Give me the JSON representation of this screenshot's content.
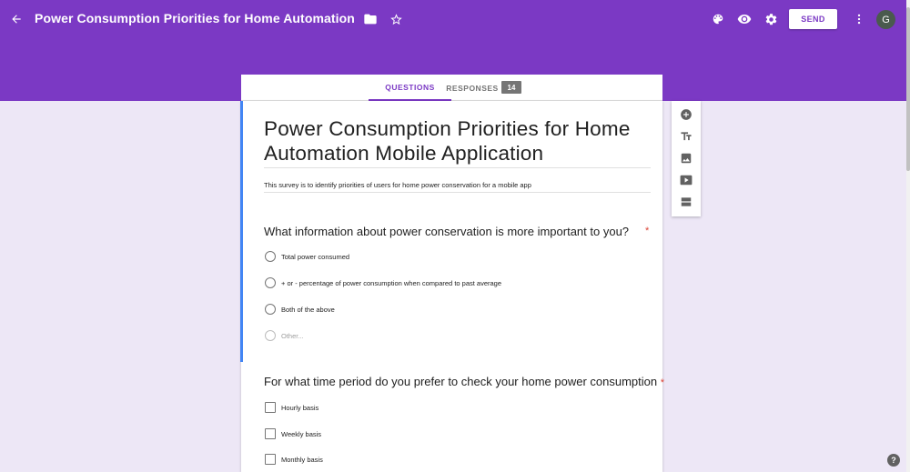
{
  "header": {
    "title": "Power Consumption Priorities for Home Automation Mobile Applic",
    "send_label": "SEND",
    "avatar_letter": "G",
    "icons": [
      "arrow-back-icon",
      "folder-icon",
      "star-icon",
      "palette-icon",
      "eye-icon",
      "gear-icon",
      "more-vert-icon"
    ]
  },
  "tabs": {
    "questions": "QUESTIONS",
    "responses": "RESPONSES",
    "responses_count": "14"
  },
  "form": {
    "title": "Power Consumption Priorities for Home Automation Mobile Application",
    "description": "This survey is to identify priorities of users for home power conservation for a mobile app"
  },
  "questions": [
    {
      "title": "What information about power conservation is more important to you?",
      "required_mark": "*",
      "type": "radio",
      "options": [
        "Total power consumed",
        "+ or - percentage of power consumption when compared to past average",
        "Both of the above",
        "Other..."
      ]
    },
    {
      "title": "For what time period do you prefer to check your home power consumption",
      "required_mark": "*",
      "type": "checkbox",
      "options": [
        "Hourly basis",
        "Weekly basis",
        "Monthly basis"
      ]
    }
  ],
  "side_toolbar": [
    "add-question-icon",
    "title-text-icon",
    "image-icon",
    "video-icon",
    "section-icon"
  ],
  "help_label": "?",
  "colors": {
    "brand": "#7b39c4",
    "page_bg": "#ede7f6",
    "active_bar": "#4285f4",
    "required": "#db4437"
  }
}
